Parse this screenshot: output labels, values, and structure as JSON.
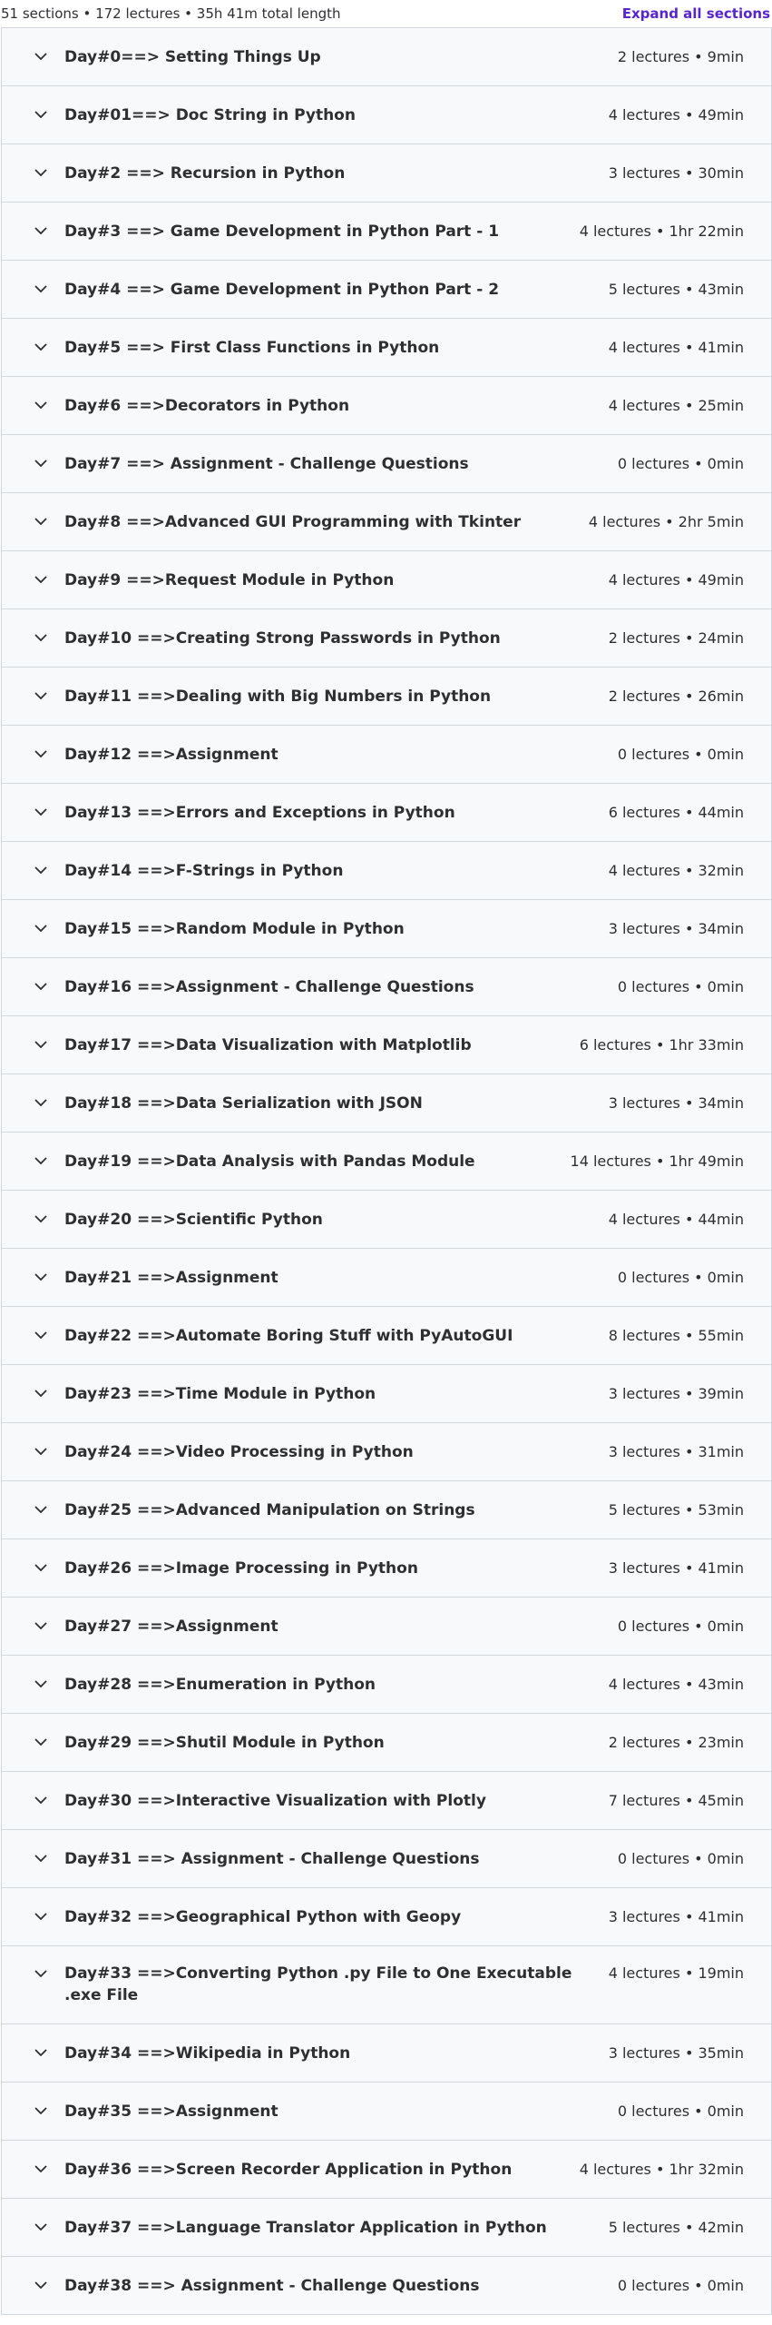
{
  "summary": {
    "text": "51 sections • 172 lectures • 35h 41m total length",
    "expand_label": "Expand all sections"
  },
  "sections": [
    {
      "title": "Day#0==> Setting Things Up",
      "meta": "2 lectures • 9min"
    },
    {
      "title": "Day#01==> Doc String in Python",
      "meta": "4 lectures • 49min"
    },
    {
      "title": "Day#2 ==> Recursion in Python",
      "meta": "3 lectures • 30min"
    },
    {
      "title": "Day#3 ==> Game Development in Python Part - 1",
      "meta": "4 lectures • 1hr 22min"
    },
    {
      "title": "Day#4 ==> Game Development in Python Part - 2",
      "meta": "5 lectures • 43min"
    },
    {
      "title": "Day#5 ==> First Class Functions in Python",
      "meta": "4 lectures • 41min"
    },
    {
      "title": "Day#6 ==>Decorators in Python",
      "meta": "4 lectures • 25min"
    },
    {
      "title": "Day#7 ==> Assignment - Challenge Questions",
      "meta": "0 lectures • 0min"
    },
    {
      "title": "Day#8 ==>Advanced GUI Programming with Tkinter",
      "meta": "4 lectures • 2hr 5min"
    },
    {
      "title": "Day#9 ==>Request Module in Python",
      "meta": "4 lectures • 49min"
    },
    {
      "title": "Day#10 ==>Creating Strong Passwords in Python",
      "meta": "2 lectures • 24min"
    },
    {
      "title": "Day#11 ==>Dealing with Big Numbers in Python",
      "meta": "2 lectures • 26min"
    },
    {
      "title": "Day#12 ==>Assignment",
      "meta": "0 lectures • 0min"
    },
    {
      "title": "Day#13 ==>Errors and Exceptions in Python",
      "meta": "6 lectures • 44min"
    },
    {
      "title": "Day#14 ==>F-Strings in Python",
      "meta": "4 lectures • 32min"
    },
    {
      "title": "Day#15 ==>Random Module in Python",
      "meta": "3 lectures • 34min"
    },
    {
      "title": "Day#16 ==>Assignment - Challenge Questions",
      "meta": "0 lectures • 0min"
    },
    {
      "title": "Day#17 ==>Data Visualization with Matplotlib",
      "meta": "6 lectures • 1hr 33min"
    },
    {
      "title": "Day#18 ==>Data Serialization with JSON",
      "meta": "3 lectures • 34min"
    },
    {
      "title": "Day#19 ==>Data Analysis with Pandas Module",
      "meta": "14 lectures • 1hr 49min"
    },
    {
      "title": "Day#20 ==>Scientific Python",
      "meta": "4 lectures • 44min"
    },
    {
      "title": "Day#21 ==>Assignment",
      "meta": "0 lectures • 0min"
    },
    {
      "title": "Day#22 ==>Automate Boring Stuff with PyAutoGUI",
      "meta": "8 lectures • 55min"
    },
    {
      "title": "Day#23 ==>Time Module in Python",
      "meta": "3 lectures • 39min"
    },
    {
      "title": "Day#24 ==>Video Processing in Python",
      "meta": "3 lectures • 31min"
    },
    {
      "title": "Day#25 ==>Advanced Manipulation on Strings",
      "meta": "5 lectures • 53min"
    },
    {
      "title": "Day#26 ==>Image Processing in Python",
      "meta": "3 lectures • 41min"
    },
    {
      "title": "Day#27 ==>Assignment",
      "meta": "0 lectures • 0min"
    },
    {
      "title": "Day#28 ==>Enumeration in Python",
      "meta": "4 lectures • 43min"
    },
    {
      "title": "Day#29 ==>Shutil Module in Python",
      "meta": "2 lectures • 23min"
    },
    {
      "title": "Day#30 ==>Interactive Visualization with Plotly",
      "meta": "7 lectures • 45min"
    },
    {
      "title": "Day#31 ==> Assignment - Challenge Questions",
      "meta": "0 lectures • 0min"
    },
    {
      "title": "Day#32 ==>Geographical Python with Geopy",
      "meta": "3 lectures • 41min"
    },
    {
      "title": "Day#33 ==>Converting Python .py File to One Executable .exe File",
      "meta": "4 lectures • 19min",
      "tall": true
    },
    {
      "title": "Day#34 ==>Wikipedia in Python",
      "meta": "3 lectures • 35min"
    },
    {
      "title": "Day#35 ==>Assignment",
      "meta": "0 lectures • 0min"
    },
    {
      "title": "Day#36 ==>Screen Recorder Application in Python",
      "meta": "4 lectures • 1hr 32min"
    },
    {
      "title": "Day#37 ==>Language Translator Application in Python",
      "meta": "5 lectures • 42min"
    },
    {
      "title": "Day#38 ==> Assignment - Challenge Questions",
      "meta": "0 lectures • 0min"
    }
  ]
}
